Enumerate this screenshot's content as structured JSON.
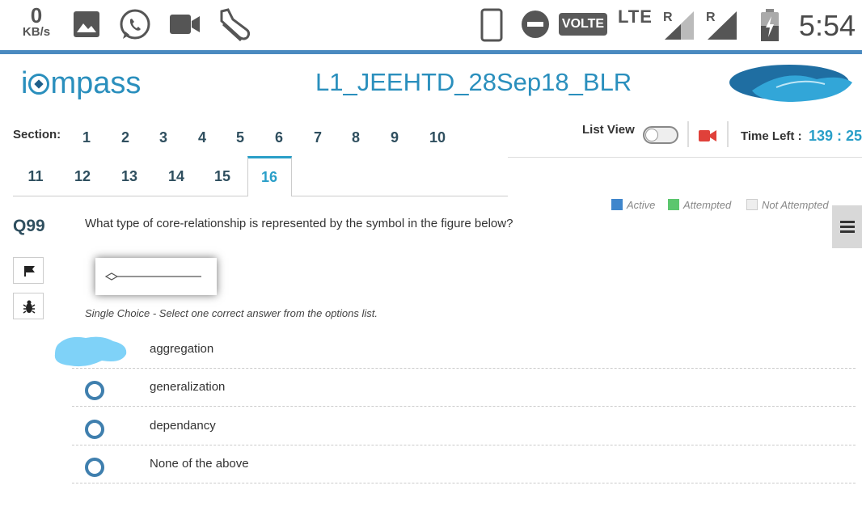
{
  "status_bar": {
    "speed_value": "0",
    "speed_unit": "KB/s",
    "volte": "VOLTE",
    "lte": "LTE",
    "roaming_1": "R",
    "roaming_2": "R",
    "time": "5:54",
    "icons": [
      "image-icon",
      "whatsapp-icon",
      "video-camera-icon",
      "shoe-icon",
      "phone-icon",
      "do-not-disturb-icon",
      "signal-icon",
      "battery-icon"
    ]
  },
  "header": {
    "logo_text_prefix": "i",
    "logo_text_suffix": "mpass",
    "title": "L1_JEEHTD_28Sep18_BLR"
  },
  "sections": {
    "label": "Section:",
    "items": [
      "1",
      "2",
      "3",
      "4",
      "5",
      "6",
      "7",
      "8",
      "9",
      "10",
      "11",
      "12",
      "13",
      "14",
      "15",
      "16"
    ],
    "active": "16"
  },
  "controls": {
    "list_view_label": "List View",
    "time_left_label": "Time Left :",
    "time_left_value": "139 : 25"
  },
  "legend": {
    "active": "Active",
    "attempted": "Attempted",
    "not_attempted": "Not Attempted"
  },
  "question": {
    "number": "Q99",
    "text": "What type of core-relationship is represented by the symbol in the figure below?",
    "hint": "Single Choice - Select one correct answer from the options list.",
    "options": [
      "aggregation",
      "generalization",
      "dependancy",
      "None of the above"
    ]
  },
  "colors": {
    "accent": "#2a9fc8",
    "active": "#3f86cc",
    "attempted": "#5cc66e",
    "not_attempted": "#eeeeee",
    "radio": "#3f7fae"
  }
}
